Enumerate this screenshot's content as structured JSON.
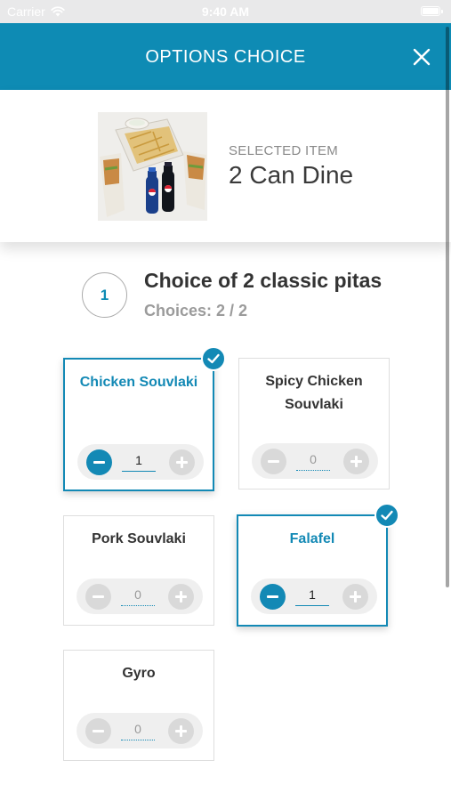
{
  "status_bar": {
    "carrier": "Carrier",
    "time": "9:40 AM"
  },
  "header": {
    "title": "OPTIONS CHOICE"
  },
  "selected": {
    "label": "SELECTED ITEM",
    "name": "2 Can Dine"
  },
  "section": {
    "step": "1",
    "title": "Choice of 2 classic pitas",
    "choices": "Choices: 2 / 2"
  },
  "options": [
    {
      "name": "Chicken Souvlaki",
      "qty": "1",
      "selected": true
    },
    {
      "name": "Spicy Chicken Souvlaki",
      "qty": "0",
      "selected": false
    },
    {
      "name": "Pork Souvlaki",
      "qty": "0",
      "selected": false
    },
    {
      "name": "Falafel",
      "qty": "1",
      "selected": true
    },
    {
      "name": "Gyro",
      "qty": "0",
      "selected": false
    }
  ],
  "colors": {
    "brand": "#0e8bb4",
    "selected_border": "#1389b5"
  }
}
